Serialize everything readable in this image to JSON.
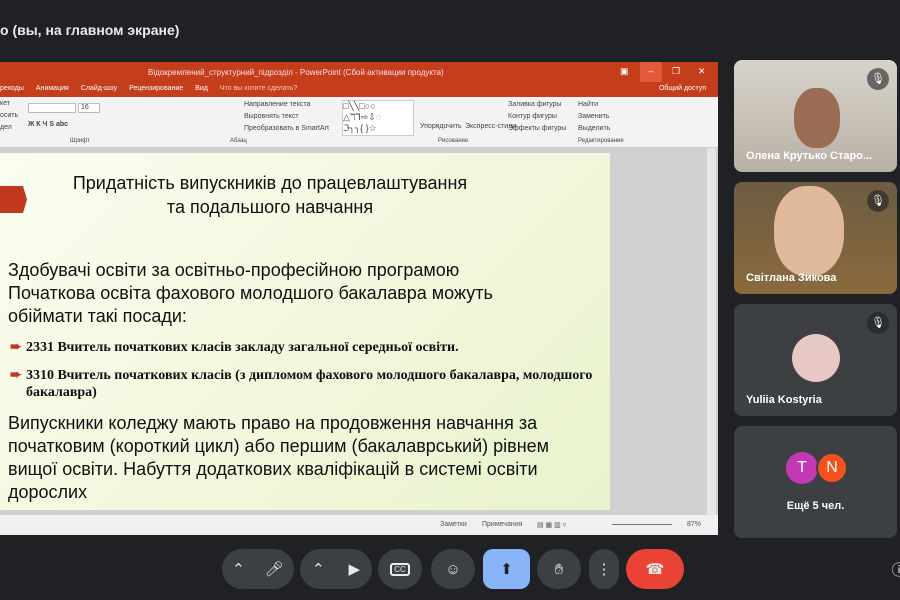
{
  "header": {
    "presenter_label": "о (вы, на главном экране)"
  },
  "ppt": {
    "window_title": "Відокремлений_структурний_підрозділ - PowerPoint (Сбой активации продукта)",
    "tabs": [
      "реходы",
      "Анимация",
      "Слайд-шоу",
      "Рецензирование",
      "Вид",
      "Что вы хотите сделать?"
    ],
    "share": "Общий доступ",
    "ribbon": {
      "font_size": "16",
      "groups": [
        "Шрифт",
        "Абзац",
        "Рисование",
        "Редактирование"
      ],
      "items": [
        "Направление текста",
        "Выровнять текст",
        "Преобразовать в SmartArt",
        "Упорядочить",
        "Экспресс-стили",
        "Заливка фигуры",
        "Контур фигуры",
        "Эффекты фигуры",
        "Найти",
        "Заменить",
        "Выделить",
        "кет",
        "осить",
        "дел"
      ]
    },
    "status": {
      "notes": "Заметки",
      "comments": "Примечания",
      "zoom": "87%"
    }
  },
  "slide": {
    "title_line1": "Придатність випускників до працевлаштування",
    "title_line2": "та подальшого навчання",
    "intro": [
      "Здобувачі освіти за освітньо-професійною програмою",
      "Початкова освіта фахового молодшого бакалавра можуть",
      "обіймати такі посади:"
    ],
    "bullets": [
      "2331 Вчитель початкових класів закладу загальної середньої освіти.",
      "3310 Вчитель початкових класів (з дипломом фахового молодшого бакалавра, молодшого бакалавра)"
    ],
    "outro": [
      "Випускники коледжу мають право на продовження навчання за",
      "початковим (короткий цикл) або першим (бакалаврський) рівнем",
      "вищої освіти. Набуття додаткових кваліфікацій в системі освіти",
      "дорослих"
    ]
  },
  "participants": [
    {
      "name": "Олена Крутько Старо..."
    },
    {
      "name": "Світлана Зикова"
    },
    {
      "name": "Yuliia Kostyria"
    },
    {
      "name": "Ещё 5 чел.",
      "avatars": [
        "T",
        "N"
      ],
      "colors": [
        "#c239b3",
        "#f4511e"
      ]
    }
  ],
  "colors": {
    "ppt": "#c43e1c",
    "end_call": "#ea4335",
    "present": "#8ab4f8"
  }
}
